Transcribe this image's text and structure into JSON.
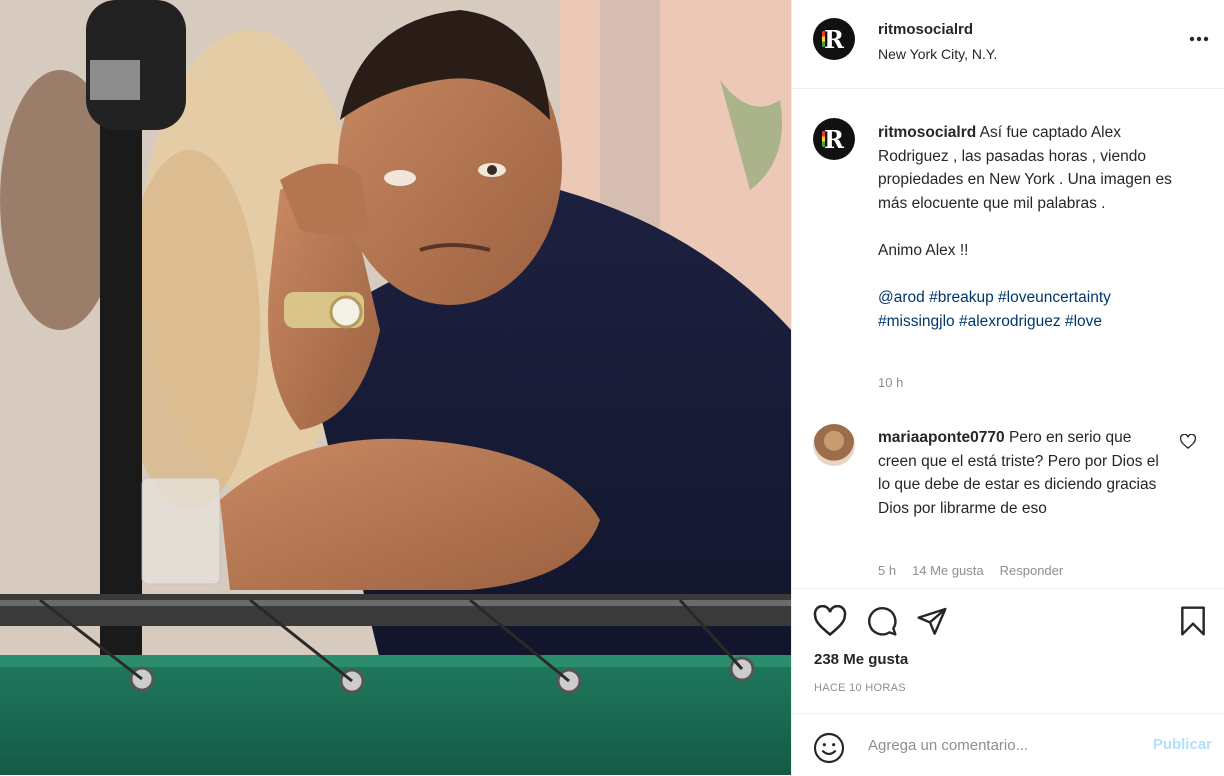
{
  "post": {
    "username": "ritmosocialrd",
    "location": "New York City, N.Y.",
    "avatar_letter": "R"
  },
  "caption": {
    "username": "ritmosocialrd",
    "text": " Así fue captado Alex Rodriguez , las pasadas horas , viendo propiedades en New York . Una imagen es más elocuente que mil palabras .\n\nAnimo Alex !!\n\n",
    "hashtags": [
      "@arod",
      "#breakup",
      "#loveuncertainty",
      "#missingjlo",
      "#alexrodriguez",
      "#love"
    ],
    "time": "10 h"
  },
  "comment": {
    "username": "mariaaponte0770",
    "text": " Pero en serio que creen que el está triste? Pero por Dios el lo que debe de estar es diciendo gracias Dios por librarme de eso",
    "time": "5 h",
    "likes": "14 Me gusta",
    "reply": "Responder"
  },
  "actions": {
    "likes": "238 Me gusta",
    "ago": "HACE 10 HORAS"
  },
  "composer": {
    "placeholder": "Agrega un comentario...",
    "publish": "Publicar"
  },
  "icons": [
    "more-icon",
    "heart-icon",
    "comment-icon",
    "share-icon",
    "bookmark-icon",
    "emoji-icon"
  ],
  "colors": {
    "hashtag": "#00376b",
    "muted": "#8e8e8e",
    "publish_disabled": "#b2dffc"
  }
}
